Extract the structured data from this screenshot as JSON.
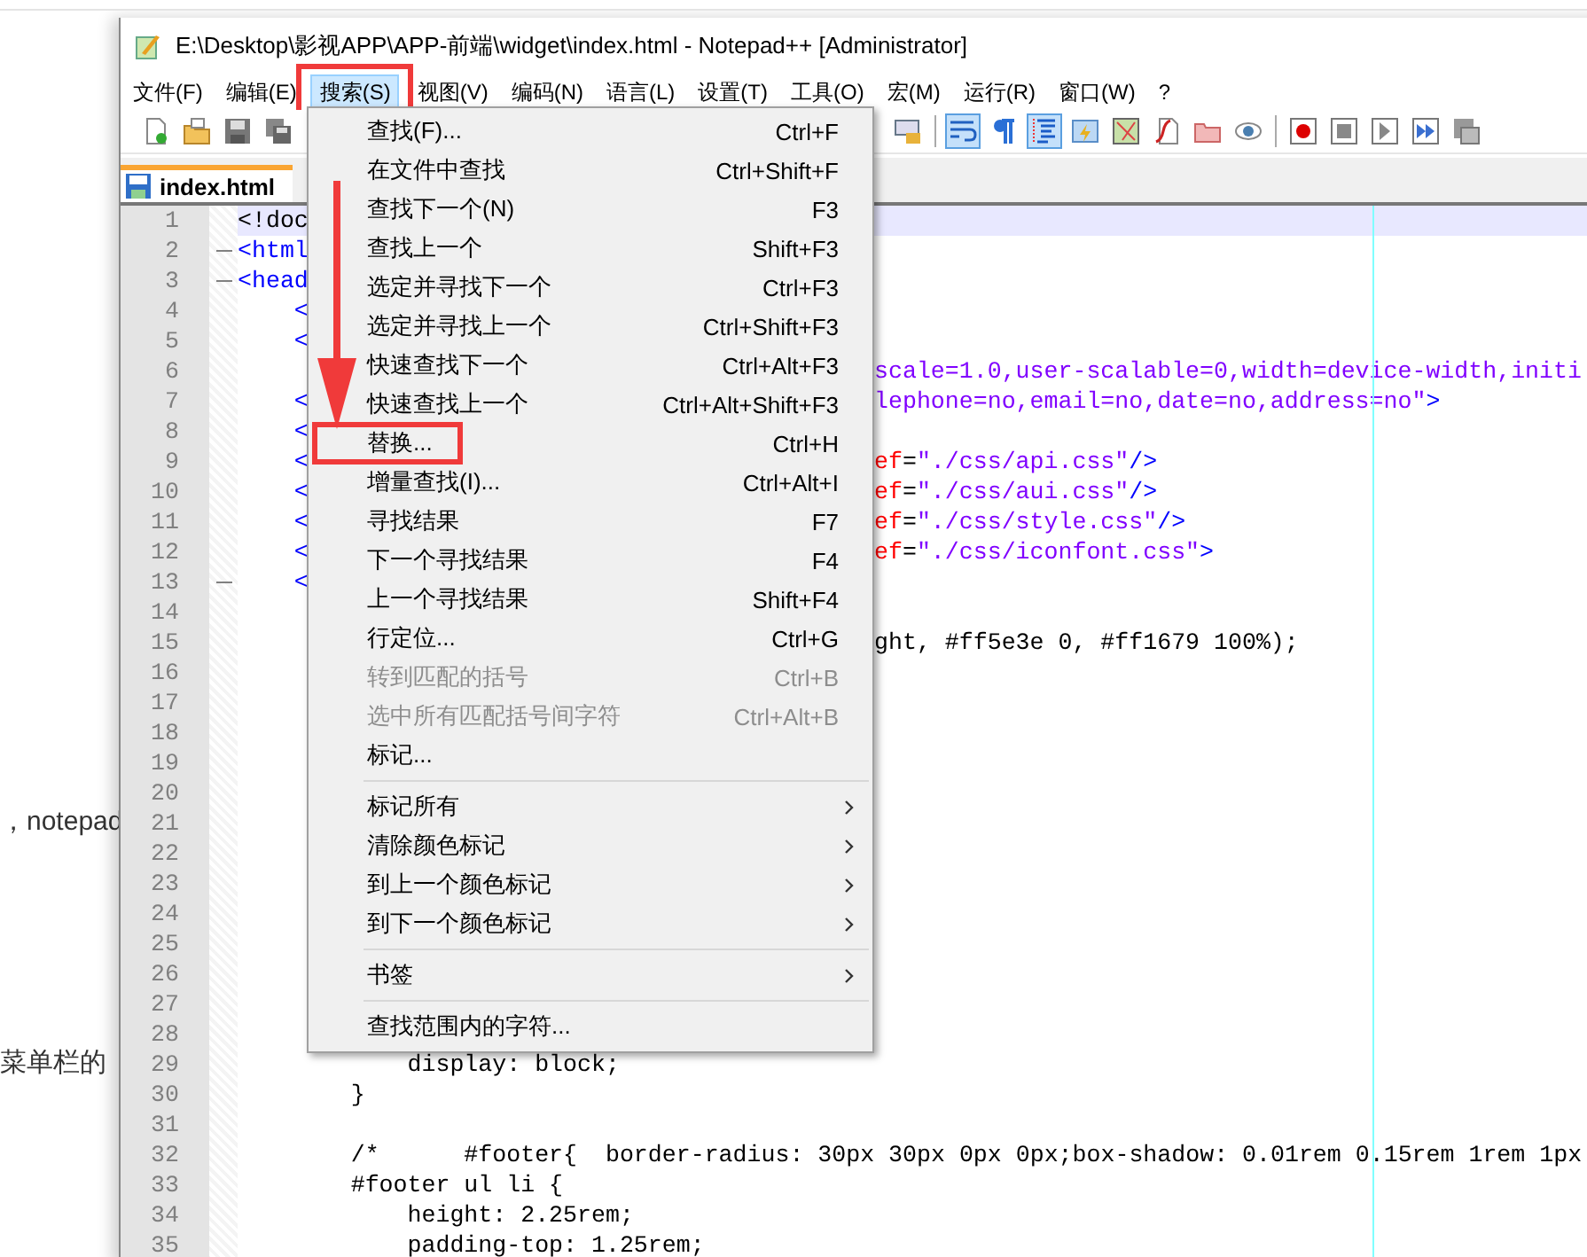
{
  "background_page": {
    "texts": [
      "，notepad",
      "菜单栏的"
    ]
  },
  "window": {
    "title": "E:\\Desktop\\影视APP\\APP-前端\\widget\\index.html - Notepad++ [Administrator]"
  },
  "menubar": [
    {
      "label": "文件(F)",
      "selected": false,
      "annotated": false
    },
    {
      "label": "编辑(E)",
      "selected": false,
      "annotated": false
    },
    {
      "label": "搜索(S)",
      "selected": true,
      "annotated": true
    },
    {
      "label": "视图(V)",
      "selected": false,
      "annotated": false
    },
    {
      "label": "编码(N)",
      "selected": false,
      "annotated": false
    },
    {
      "label": "语言(L)",
      "selected": false,
      "annotated": false
    },
    {
      "label": "设置(T)",
      "selected": false,
      "annotated": false
    },
    {
      "label": "工具(O)",
      "selected": false,
      "annotated": false
    },
    {
      "label": "宏(M)",
      "selected": false,
      "annotated": false
    },
    {
      "label": "运行(R)",
      "selected": false,
      "annotated": false
    },
    {
      "label": "窗口(W)",
      "selected": false,
      "annotated": false
    },
    {
      "label": "?",
      "selected": false,
      "annotated": false
    }
  ],
  "toolbar": {
    "left": [
      {
        "pressed": false
      },
      {
        "pressed": false
      },
      {
        "pressed": false
      },
      {
        "pressed": false
      }
    ],
    "right": [
      {
        "pressed": false
      },
      {
        "pressed": true
      },
      {
        "pressed": false
      },
      {
        "pressed": true
      },
      {
        "pressed": false
      },
      {
        "pressed": false
      },
      {
        "pressed": false
      },
      {
        "pressed": false
      },
      {
        "pressed": false
      },
      {
        "pressed": false
      },
      {
        "pressed": false
      },
      {
        "pressed": false
      },
      {
        "pressed": false
      },
      {
        "pressed": false
      }
    ]
  },
  "tabs": [
    {
      "label": "index.html",
      "selected": true
    }
  ],
  "editor": {
    "lines": [
      {
        "number": "1",
        "fold": false,
        "current": true,
        "kind": "split",
        "left": [
          {
            "kind": "plain",
            "text": "<!doc"
          }
        ]
      },
      {
        "number": "2",
        "fold": true,
        "current": false,
        "kind": "split",
        "left": [
          {
            "kind": "tag",
            "text": "<html"
          }
        ]
      },
      {
        "number": "3",
        "fold": true,
        "current": false,
        "kind": "split",
        "left": [
          {
            "kind": "tag",
            "text": "<head"
          }
        ]
      },
      {
        "number": "4",
        "fold": false,
        "current": false,
        "kind": "split",
        "left": [
          {
            "kind": "tag",
            "text": "    <"
          }
        ]
      },
      {
        "number": "5",
        "fold": false,
        "current": false,
        "kind": "split",
        "left": [
          {
            "kind": "tag",
            "text": "    <"
          }
        ]
      },
      {
        "number": "6",
        "fold": false,
        "current": false,
        "kind": "split",
        "right": [
          {
            "kind": "value",
            "text": "scale=1.0,user-scalable=0,width=device-width,initi"
          }
        ]
      },
      {
        "number": "7",
        "fold": false,
        "current": false,
        "kind": "split",
        "left": [
          {
            "kind": "tag",
            "text": "    <"
          }
        ],
        "right": [
          {
            "kind": "value",
            "text": "lephone=no,email=no,date=no,address=no\""
          },
          {
            "kind": "tag",
            "text": ">"
          }
        ]
      },
      {
        "number": "8",
        "fold": false,
        "current": false,
        "kind": "split",
        "left": [
          {
            "kind": "tag",
            "text": "    <"
          }
        ]
      },
      {
        "number": "9",
        "fold": false,
        "current": false,
        "kind": "split",
        "left": [
          {
            "kind": "tag",
            "text": "    <"
          }
        ],
        "right": [
          {
            "kind": "attr",
            "text": "ef"
          },
          {
            "kind": "plain",
            "text": "="
          },
          {
            "kind": "value",
            "text": "\"./css/api.css\""
          },
          {
            "kind": "tag",
            "text": "/>"
          }
        ]
      },
      {
        "number": "10",
        "fold": false,
        "current": false,
        "kind": "split",
        "left": [
          {
            "kind": "tag",
            "text": "    <"
          }
        ],
        "right": [
          {
            "kind": "attr",
            "text": "ef"
          },
          {
            "kind": "plain",
            "text": "="
          },
          {
            "kind": "value",
            "text": "\"./css/aui.css\""
          },
          {
            "kind": "tag",
            "text": "/>"
          }
        ]
      },
      {
        "number": "11",
        "fold": false,
        "current": false,
        "kind": "split",
        "left": [
          {
            "kind": "tag",
            "text": "    <"
          }
        ],
        "right": [
          {
            "kind": "attr",
            "text": "ef"
          },
          {
            "kind": "plain",
            "text": "="
          },
          {
            "kind": "value",
            "text": "\"./css/style.css\""
          },
          {
            "kind": "tag",
            "text": "/>"
          }
        ]
      },
      {
        "number": "12",
        "fold": false,
        "current": false,
        "kind": "split",
        "left": [
          {
            "kind": "tag",
            "text": "    <"
          }
        ],
        "right": [
          {
            "kind": "attr",
            "text": "ef"
          },
          {
            "kind": "plain",
            "text": "="
          },
          {
            "kind": "value",
            "text": "\"./css/iconfont.css\""
          },
          {
            "kind": "tag",
            "text": ">"
          }
        ]
      },
      {
        "number": "13",
        "fold": true,
        "current": false,
        "kind": "split",
        "left": [
          {
            "kind": "tag",
            "text": "    <"
          }
        ]
      },
      {
        "number": "14",
        "fold": false,
        "current": false,
        "kind": "blank"
      },
      {
        "number": "15",
        "fold": false,
        "current": false,
        "kind": "split",
        "right": [
          {
            "kind": "plain",
            "text": "ght, #ff5e3e 0, #ff1679 100%);"
          }
        ]
      },
      {
        "number": "16",
        "fold": false,
        "current": false,
        "kind": "blank"
      },
      {
        "number": "17",
        "fold": false,
        "current": false,
        "kind": "blank"
      },
      {
        "number": "18",
        "fold": false,
        "current": false,
        "kind": "blank"
      },
      {
        "number": "19",
        "fold": false,
        "current": false,
        "kind": "blank"
      },
      {
        "number": "20",
        "fold": false,
        "current": false,
        "kind": "blank"
      },
      {
        "number": "21",
        "fold": false,
        "current": false,
        "kind": "blank"
      },
      {
        "number": "22",
        "fold": false,
        "current": false,
        "kind": "blank"
      },
      {
        "number": "23",
        "fold": false,
        "current": false,
        "kind": "blank"
      },
      {
        "number": "24",
        "fold": false,
        "current": false,
        "kind": "blank"
      },
      {
        "number": "25",
        "fold": false,
        "current": false,
        "kind": "blank"
      },
      {
        "number": "26",
        "fold": false,
        "current": false,
        "kind": "blank"
      },
      {
        "number": "27",
        "fold": false,
        "current": false,
        "kind": "blank"
      },
      {
        "number": "28",
        "fold": false,
        "current": false,
        "kind": "blank"
      },
      {
        "number": "29",
        "fold": false,
        "current": false,
        "kind": "full",
        "text": "            display: block;"
      },
      {
        "number": "30",
        "fold": false,
        "current": false,
        "kind": "full",
        "text": "        }"
      },
      {
        "number": "31",
        "fold": false,
        "current": false,
        "kind": "blank"
      },
      {
        "number": "32",
        "fold": false,
        "current": false,
        "kind": "full",
        "text": "        /*      #footer{  border-radius: 30px 30px 0px 0px;box-shadow: 0.01rem 0.15rem 1rem 1px"
      },
      {
        "number": "33",
        "fold": false,
        "current": false,
        "kind": "full",
        "text": "        #footer ul li {"
      },
      {
        "number": "34",
        "fold": false,
        "current": false,
        "kind": "full",
        "text": "            height: 2.25rem;"
      },
      {
        "number": "35",
        "fold": false,
        "current": false,
        "kind": "full",
        "text": "            padding-top: 1.25rem;"
      }
    ]
  },
  "search_menu": [
    {
      "kind": "item",
      "label": "查找(F)...",
      "shortcut": "Ctrl+F",
      "disabled": false,
      "annotated": false
    },
    {
      "kind": "item",
      "label": "在文件中查找",
      "shortcut": "Ctrl+Shift+F",
      "disabled": false,
      "annotated": false
    },
    {
      "kind": "item",
      "label": "查找下一个(N)",
      "shortcut": "F3",
      "disabled": false,
      "annotated": false
    },
    {
      "kind": "item",
      "label": "查找上一个",
      "shortcut": "Shift+F3",
      "disabled": false,
      "annotated": false
    },
    {
      "kind": "item",
      "label": "选定并寻找下一个",
      "shortcut": "Ctrl+F3",
      "disabled": false,
      "annotated": false
    },
    {
      "kind": "item",
      "label": "选定并寻找上一个",
      "shortcut": "Ctrl+Shift+F3",
      "disabled": false,
      "annotated": false
    },
    {
      "kind": "item",
      "label": "快速查找下一个",
      "shortcut": "Ctrl+Alt+F3",
      "disabled": false,
      "annotated": false
    },
    {
      "kind": "item",
      "label": "快速查找上一个",
      "shortcut": "Ctrl+Alt+Shift+F3",
      "disabled": false,
      "annotated": false
    },
    {
      "kind": "item",
      "label": "替换...",
      "shortcut": "Ctrl+H",
      "disabled": false,
      "annotated": true
    },
    {
      "kind": "item",
      "label": "增量查找(I)...",
      "shortcut": "Ctrl+Alt+I",
      "disabled": false,
      "annotated": false
    },
    {
      "kind": "item",
      "label": "寻找结果",
      "shortcut": "F7",
      "disabled": false,
      "annotated": false
    },
    {
      "kind": "item",
      "label": "下一个寻找结果",
      "shortcut": "F4",
      "disabled": false,
      "annotated": false
    },
    {
      "kind": "item",
      "label": "上一个寻找结果",
      "shortcut": "Shift+F4",
      "disabled": false,
      "annotated": false
    },
    {
      "kind": "item",
      "label": "行定位...",
      "shortcut": "Ctrl+G",
      "disabled": false,
      "annotated": false
    },
    {
      "kind": "item",
      "label": "转到匹配的括号",
      "shortcut": "Ctrl+B",
      "disabled": true,
      "annotated": false
    },
    {
      "kind": "item",
      "label": "选中所有匹配括号间字符",
      "shortcut": "Ctrl+Alt+B",
      "disabled": true,
      "annotated": false
    },
    {
      "kind": "item",
      "label": "标记...",
      "disabled": false,
      "annotated": false
    },
    {
      "kind": "separator"
    },
    {
      "kind": "submenu",
      "label": "标记所有",
      "disabled": false,
      "annotated": false
    },
    {
      "kind": "submenu",
      "label": "清除颜色标记",
      "disabled": false,
      "annotated": false
    },
    {
      "kind": "submenu",
      "label": "到上一个颜色标记",
      "disabled": false,
      "annotated": false
    },
    {
      "kind": "submenu",
      "label": "到下一个颜色标记",
      "disabled": false,
      "annotated": false
    },
    {
      "kind": "separator"
    },
    {
      "kind": "submenu",
      "label": "书签",
      "disabled": false,
      "annotated": false
    },
    {
      "kind": "separator"
    },
    {
      "kind": "item",
      "label": "查找范围内的字符...",
      "disabled": false,
      "annotated": false
    }
  ]
}
